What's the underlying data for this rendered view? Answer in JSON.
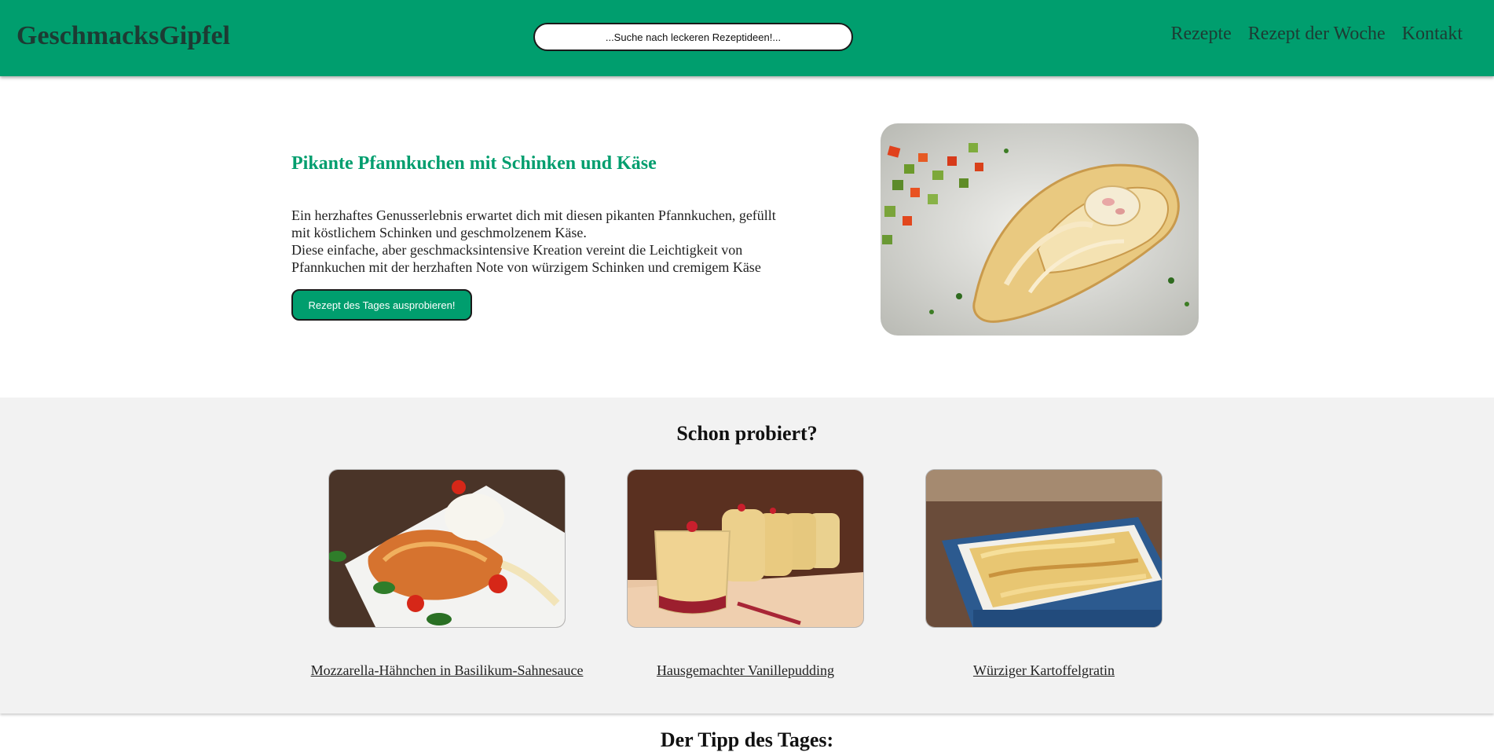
{
  "header": {
    "logo": "GeschmacksGipfel",
    "search_placeholder": "...Suche nach leckeren Rezeptideen!...",
    "nav": [
      "Rezepte",
      "Rezept der Woche",
      "Kontakt"
    ]
  },
  "hero": {
    "title": "Pikante Pfannkuchen mit Schinken und Käse",
    "text": "Ein herzhaftes Genusserlebnis erwartet dich mit diesen pikanten Pfannkuchen, gefüllt mit köstlichem Schinken und geschmolzenem Käse.\nDiese einfache, aber geschmacksintensive Kreation vereint die Leichtigkeit von Pfannkuchen mit der herzhaften Note von würzigem Schinken und cremigem Käse",
    "button": "Rezept des Tages ausprobieren!"
  },
  "tried": {
    "title": "Schon probiert?",
    "cards": [
      {
        "label": "Mozzarella-Hähnchen in Basilikum-Sahnesauce"
      },
      {
        "label": "Hausgemachter Vanillepudding"
      },
      {
        "label": "Würziger Kartoffelgratin"
      }
    ]
  },
  "tip": {
    "title": "Der Tipp des Tages:"
  },
  "colors": {
    "brand": "#009e6e",
    "section_bg": "#f2f2f2"
  }
}
